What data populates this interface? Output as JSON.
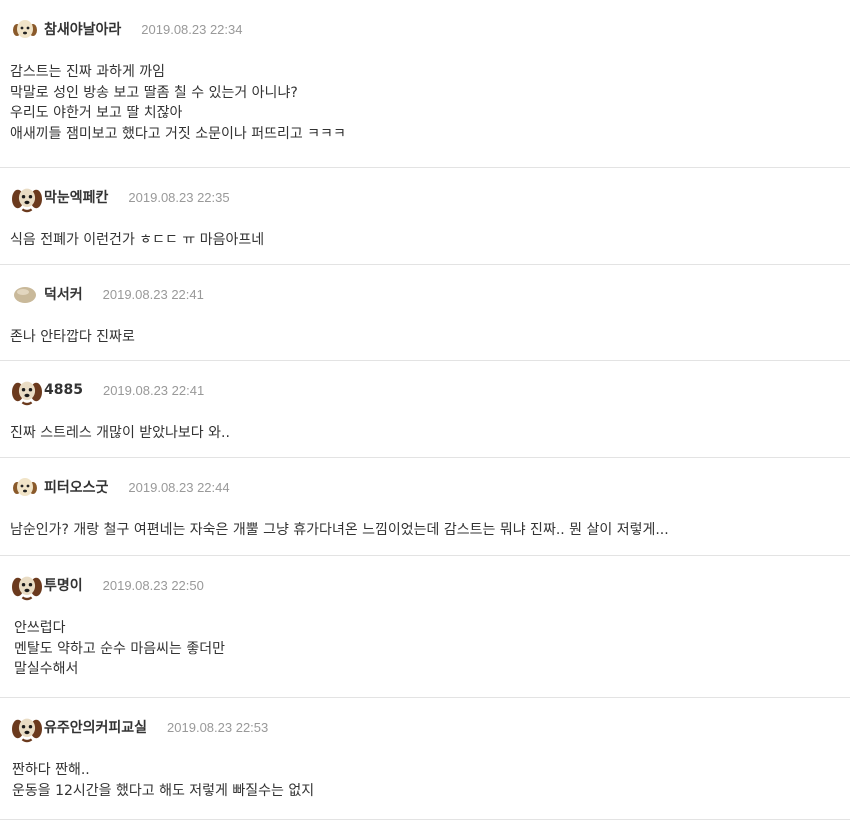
{
  "comments": [
    {
      "nickname": "참새야날아라",
      "avatar_icon": "tan-dog-avatar-icon",
      "date": "2019.08.23 22:34",
      "lines": [
        "감스트는 진짜 과하게 까임",
        "막말로 성인 방송 보고 딸좀 칠 수 있는거 아니냐?",
        "우리도 야한거 보고 딸 치잖아",
        "애새끼들 잼미보고 했다고 거짓 소문이나 퍼뜨리고 ㅋㅋㅋ"
      ]
    },
    {
      "nickname": "막눈엑페칸",
      "avatar_icon": "brown-dog-avatar-icon",
      "date": "2019.08.23 22:35",
      "lines": [
        "식음 전폐가 이런건가 ㅎㄷㄷ ㅠ 마음아프네"
      ]
    },
    {
      "nickname": "덕서커",
      "avatar_icon": "stone-avatar-icon",
      "date": "2019.08.23 22:41",
      "lines": [
        "존나 안타깝다 진짜로"
      ]
    },
    {
      "nickname": "4885",
      "avatar_icon": "brown-dog-avatar-icon",
      "date": "2019.08.23 22:41",
      "lines": [
        "진짜 스트레스 개많이 받았나보다 와.."
      ]
    },
    {
      "nickname": "피터오스굿",
      "avatar_icon": "tan-dog-avatar-icon",
      "date": "2019.08.23 22:44",
      "lines": [
        "남순인가? 개랑 철구 여편네는 자숙은 개뿔 그냥 휴가다녀온 느낌이었는데 감스트는 뭐냐 진짜.. 뭔 살이 저렇게..."
      ]
    },
    {
      "nickname": "투명이",
      "avatar_icon": "brown-dog-avatar-icon",
      "date": "2019.08.23 22:50",
      "lines": [
        "안쓰럽다",
        "멘탈도 약하고 순수 마음씨는 좋더만",
        "말실수해서"
      ]
    },
    {
      "nickname": "유주안의커피교실",
      "avatar_icon": "brown-dog-avatar-icon",
      "date": "2019.08.23 22:53",
      "lines": [
        "짠하다 짠해..",
        "운동을 12시간을 했다고 해도 저렇게 빠질수는 없지"
      ]
    }
  ],
  "colors": {
    "divider": "#e3e3e3",
    "nickname": "#333333",
    "date": "#999999",
    "text": "#333333"
  }
}
